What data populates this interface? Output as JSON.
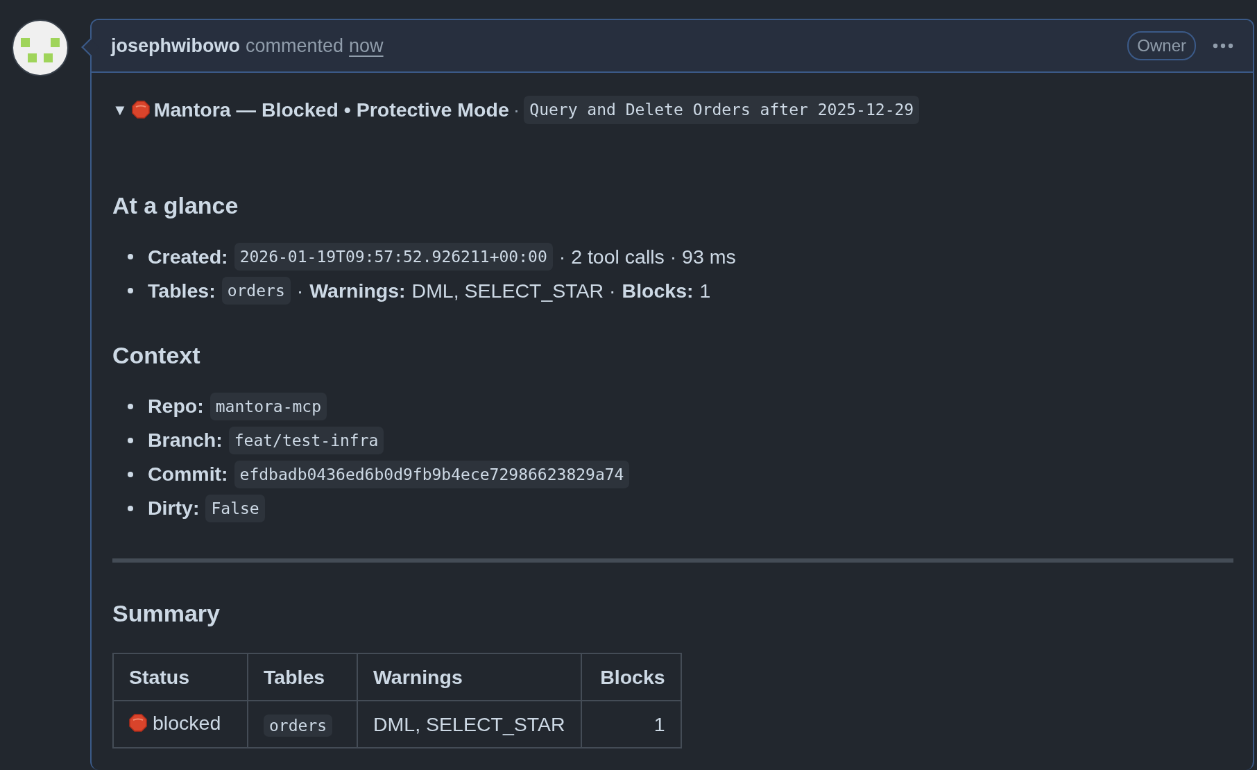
{
  "comment": {
    "author": "josephwibowo",
    "action": "commented",
    "time": "now",
    "badge": "Owner"
  },
  "details": {
    "expanded": true,
    "toggle": "▼",
    "title": "Mantora — Blocked • Protective Mode",
    "separator": "·",
    "query": "Query and Delete Orders after 2025-12-29"
  },
  "sections": [
    {
      "heading": "At a glance",
      "items": [
        [
          {
            "kind": "label",
            "text": "Created:"
          },
          {
            "kind": "code",
            "text": "2026-01-19T09:57:52.926211+00:00"
          },
          {
            "kind": "text",
            "text": "· 2 tool calls · 93 ms"
          }
        ],
        [
          {
            "kind": "label",
            "text": "Tables:"
          },
          {
            "kind": "code",
            "text": "orders"
          },
          {
            "kind": "text",
            "text": "·"
          },
          {
            "kind": "label",
            "text": "Warnings:"
          },
          {
            "kind": "text",
            "text": "DML, SELECT_STAR ·"
          },
          {
            "kind": "label",
            "text": "Blocks:"
          },
          {
            "kind": "text",
            "text": "1"
          }
        ]
      ]
    },
    {
      "heading": "Context",
      "items": [
        [
          {
            "kind": "label",
            "text": "Repo:"
          },
          {
            "kind": "code",
            "text": "mantora-mcp"
          }
        ],
        [
          {
            "kind": "label",
            "text": "Branch:"
          },
          {
            "kind": "code",
            "text": "feat/test-infra"
          }
        ],
        [
          {
            "kind": "label",
            "text": "Commit:"
          },
          {
            "kind": "code",
            "text": "efdbadb0436ed6b0d9fb9b4ece72986623829a74"
          }
        ],
        [
          {
            "kind": "label",
            "text": "Dirty:"
          },
          {
            "kind": "code",
            "text": "False"
          }
        ]
      ]
    }
  ],
  "summary": {
    "heading": "Summary",
    "table": {
      "columns": [
        {
          "label": "Status",
          "numeric": false
        },
        {
          "label": "Tables",
          "numeric": false
        },
        {
          "label": "Warnings",
          "numeric": false
        },
        {
          "label": "Blocks",
          "numeric": true
        }
      ],
      "rows": [
        [
          {
            "kind": "status",
            "text": "blocked"
          },
          {
            "kind": "code",
            "text": "orders"
          },
          {
            "kind": "text",
            "text": "DML, SELECT_STAR"
          },
          {
            "kind": "text",
            "text": "1"
          }
        ]
      ]
    }
  }
}
